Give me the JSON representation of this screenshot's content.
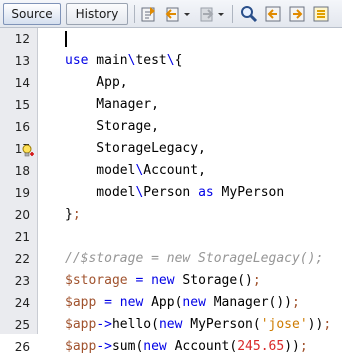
{
  "toolbar": {
    "tab_source": "Source",
    "tab_history": "History",
    "icons": [
      "last-edit-icon",
      "back-icon",
      "forward-icon",
      "find-icon",
      "find-previous-icon",
      "find-next-icon",
      "toggle-highlight-icon"
    ]
  },
  "colors": {
    "keyword": "#0000e6",
    "variable": "#a0522d",
    "number": "#d92929",
    "string": "#ce7b00",
    "comment": "#969696"
  },
  "editor": {
    "lines": [
      {
        "num": "12",
        "tokens": []
      },
      {
        "num": "13",
        "tokens": [
          {
            "t": "kw",
            "v": "use"
          },
          {
            "t": "op",
            "v": " main"
          },
          {
            "t": "kw",
            "v": "\\"
          },
          {
            "t": "op",
            "v": "test"
          },
          {
            "t": "kw",
            "v": "\\"
          },
          {
            "t": "op",
            "v": "{"
          }
        ]
      },
      {
        "num": "14",
        "tokens": [
          {
            "t": "op",
            "v": "    App,"
          }
        ]
      },
      {
        "num": "15",
        "tokens": [
          {
            "t": "op",
            "v": "    Manager,"
          }
        ]
      },
      {
        "num": "16",
        "tokens": [
          {
            "t": "op",
            "v": "    Storage,"
          }
        ]
      },
      {
        "num": "17",
        "tokens": [
          {
            "t": "op",
            "v": "    StorageLegacy,"
          }
        ]
      },
      {
        "num": "18",
        "tokens": [
          {
            "t": "op",
            "v": "    model"
          },
          {
            "t": "kw",
            "v": "\\"
          },
          {
            "t": "op",
            "v": "Account,"
          }
        ]
      },
      {
        "num": "19",
        "tokens": [
          {
            "t": "op",
            "v": "    model"
          },
          {
            "t": "kw",
            "v": "\\"
          },
          {
            "t": "op",
            "v": "Person "
          },
          {
            "t": "kw",
            "v": "as"
          },
          {
            "t": "op",
            "v": " MyPerson"
          }
        ]
      },
      {
        "num": "20",
        "tokens": [
          {
            "t": "op",
            "v": "}"
          },
          {
            "t": "var",
            "v": ";"
          }
        ]
      },
      {
        "num": "21",
        "tokens": []
      },
      {
        "num": "22",
        "tokens": [
          {
            "t": "cm",
            "v": "//$storage = new StorageLegacy();"
          }
        ]
      },
      {
        "num": "23",
        "tokens": [
          {
            "t": "var",
            "v": "$storage"
          },
          {
            "t": "op",
            "v": " "
          },
          {
            "t": "kw",
            "v": "="
          },
          {
            "t": "op",
            "v": " "
          },
          {
            "t": "kw",
            "v": "new"
          },
          {
            "t": "op",
            "v": " Storage()"
          },
          {
            "t": "var",
            "v": ";"
          }
        ]
      },
      {
        "num": "24",
        "tokens": [
          {
            "t": "var",
            "v": "$app"
          },
          {
            "t": "op",
            "v": " "
          },
          {
            "t": "kw",
            "v": "="
          },
          {
            "t": "op",
            "v": " "
          },
          {
            "t": "kw",
            "v": "new"
          },
          {
            "t": "op",
            "v": " App("
          },
          {
            "t": "kw",
            "v": "new"
          },
          {
            "t": "op",
            "v": " Manager())"
          },
          {
            "t": "var",
            "v": ";"
          }
        ]
      },
      {
        "num": "25",
        "tokens": [
          {
            "t": "var",
            "v": "$app"
          },
          {
            "t": "kw",
            "v": "->"
          },
          {
            "t": "op",
            "v": "hello("
          },
          {
            "t": "kw",
            "v": "new"
          },
          {
            "t": "op",
            "v": " MyPerson("
          },
          {
            "t": "str",
            "v": "'jose'"
          },
          {
            "t": "op",
            "v": "))"
          },
          {
            "t": "var",
            "v": ";"
          }
        ]
      },
      {
        "num": "26",
        "tokens": [
          {
            "t": "var",
            "v": "$app"
          },
          {
            "t": "kw",
            "v": "->"
          },
          {
            "t": "op",
            "v": "sum("
          },
          {
            "t": "kw",
            "v": "new"
          },
          {
            "t": "op",
            "v": " Account("
          },
          {
            "t": "num",
            "v": "245.65"
          },
          {
            "t": "op",
            "v": "))"
          },
          {
            "t": "var",
            "v": ";"
          }
        ]
      }
    ],
    "hint_line": "17"
  }
}
